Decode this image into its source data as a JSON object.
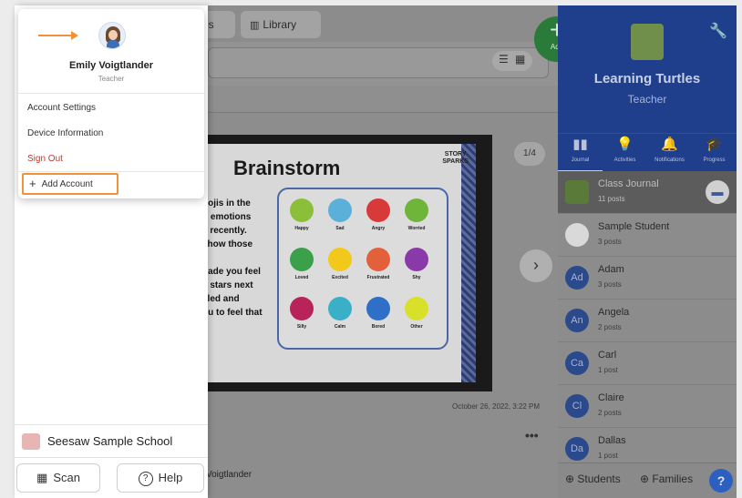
{
  "top_tabs": {
    "people_fragment": "es",
    "library_label": "Library"
  },
  "add_fab": {
    "plus": "+",
    "label": "Add"
  },
  "post": {
    "title": "Brainstorm",
    "text_lines": [
      "nojis in the",
      "h emotions",
      "y recently.",
      "show those",
      "",
      "nade you feel",
      "e stars next",
      "cled and",
      "ou to feel that"
    ],
    "logo": "STORY SPARKS",
    "faces": [
      {
        "label": "Happy",
        "color": "#8bbf3a"
      },
      {
        "label": "Sad",
        "color": "#5ab0d8"
      },
      {
        "label": "Angry",
        "color": "#d83a3a"
      },
      {
        "label": "Worried",
        "color": "#6fb53a"
      },
      {
        "label": "Loved",
        "color": "#3aa04a"
      },
      {
        "label": "Excited",
        "color": "#f2c81a"
      },
      {
        "label": "Frustrated",
        "color": "#e2603a"
      },
      {
        "label": "Shy",
        "color": "#8a3aa8"
      },
      {
        "label": "Silly",
        "color": "#b8245a"
      },
      {
        "label": "Calm",
        "color": "#3ab0c8"
      },
      {
        "label": "Bored",
        "color": "#2f6fc8"
      },
      {
        "label": "Other",
        "color": "#d8e02a"
      }
    ],
    "page_counter": "1/4",
    "timestamp": "October 26, 2022, 3:22 PM",
    "more": "•••",
    "author": "Voigtlander"
  },
  "class_panel": {
    "name": "Learning Turtles",
    "role": "Teacher",
    "tabs": [
      {
        "label": "Journal",
        "icon": "▮▮"
      },
      {
        "label": "Activities",
        "icon": "💡"
      },
      {
        "label": "Notifications",
        "icon": "🔔"
      },
      {
        "label": "Progress",
        "icon": "🎓"
      }
    ],
    "rows": [
      {
        "name": "Class Journal",
        "sub": "11 posts",
        "avatar": ""
      },
      {
        "name": "Sample Student",
        "sub": "3 posts",
        "avatar": ""
      },
      {
        "name": "Adam",
        "sub": "3 posts",
        "avatar": "Ad"
      },
      {
        "name": "Angela",
        "sub": "2 posts",
        "avatar": "An"
      },
      {
        "name": "Carl",
        "sub": "1 post",
        "avatar": "Ca"
      },
      {
        "name": "Claire",
        "sub": "2 posts",
        "avatar": "Cl"
      },
      {
        "name": "Dallas",
        "sub": "1 post",
        "avatar": "Da"
      }
    ],
    "footer": {
      "students": "Students",
      "families": "Families",
      "help": "?"
    }
  },
  "account_menu": {
    "user_name": "Emily Voigtlander",
    "user_role": "Teacher",
    "items": [
      "Account Settings",
      "Device Information",
      "Sign Out"
    ],
    "add_account": "Add Account"
  },
  "drawer": {
    "school_name": "Seesaw Sample School",
    "scan_label": "Scan",
    "help_label": "Help"
  },
  "colors": {
    "accent_orange": "#f0923a",
    "signout_red": "#d0312d",
    "class_blue": "#1f3f8c",
    "add_green": "#2a7a3a"
  }
}
